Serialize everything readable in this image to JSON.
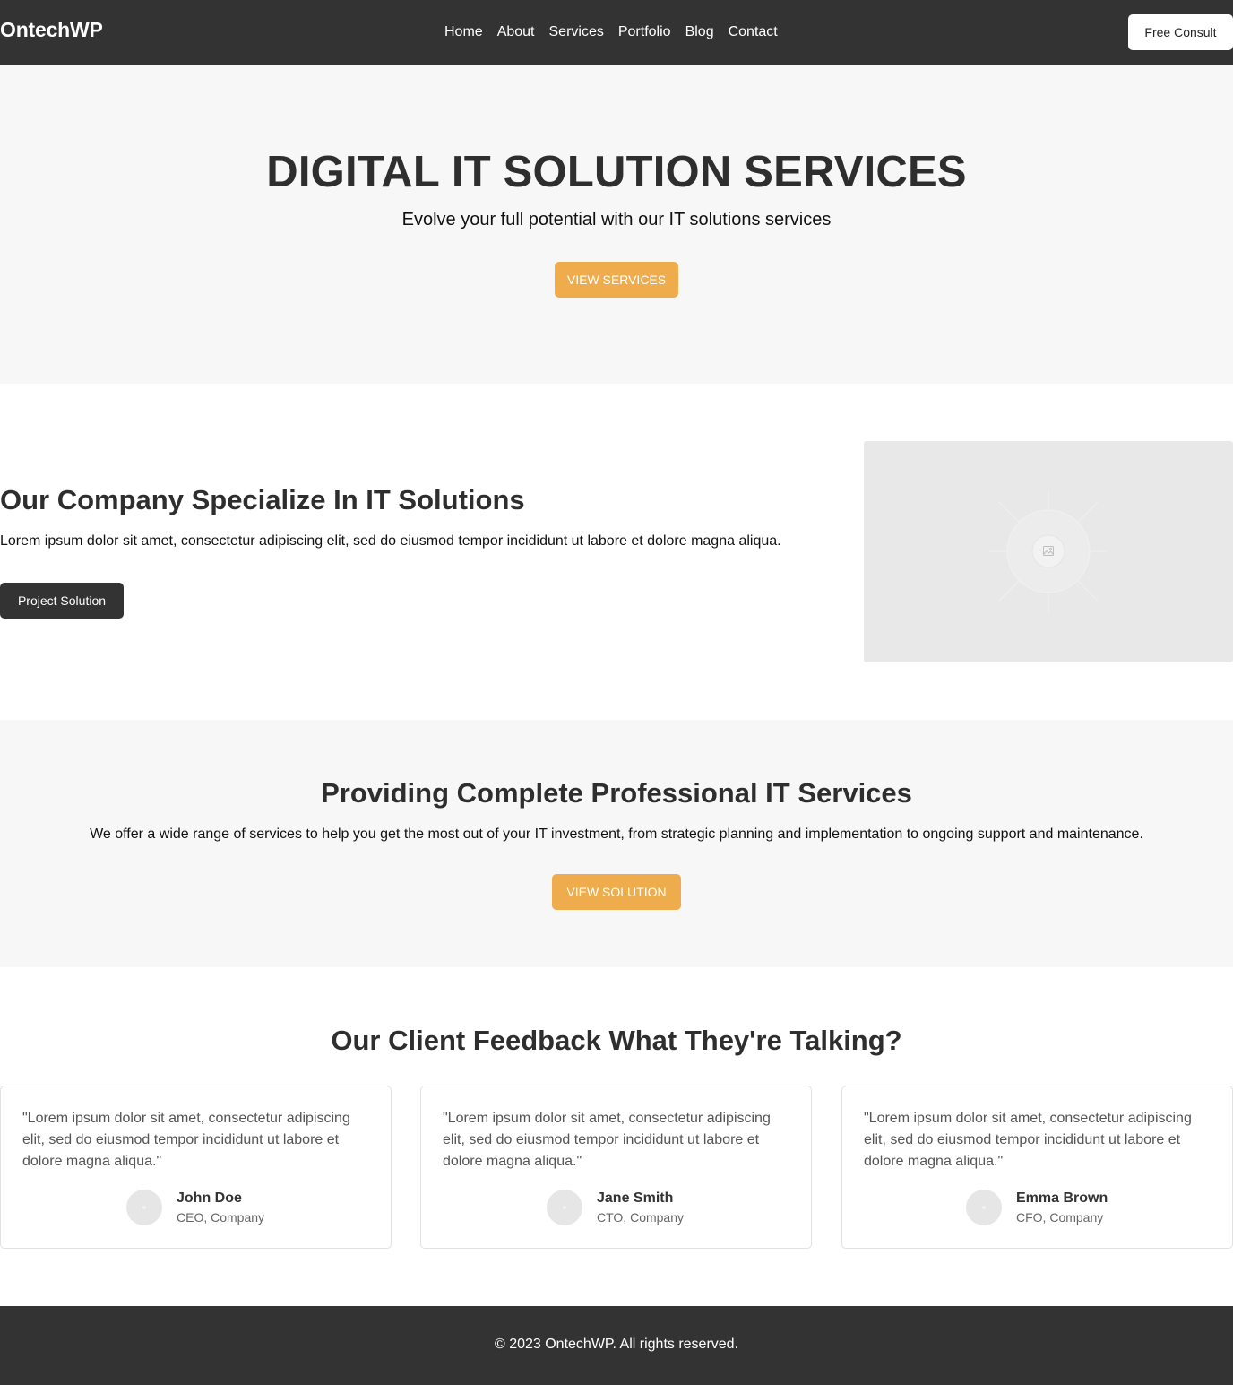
{
  "header": {
    "logo": "OntechWP",
    "nav": [
      "Home",
      "About",
      "Services",
      "Portfolio",
      "Blog",
      "Contact"
    ],
    "consult_label": "Free Consult"
  },
  "hero": {
    "title": "DIGITAL IT SOLUTION SERVICES",
    "subtitle": "Evolve your full potential with our IT solutions services",
    "button_label": "VIEW SERVICES"
  },
  "specialize": {
    "title": "Our Company Specialize In IT Solutions",
    "text": "Lorem ipsum dolor sit amet, consectetur adipiscing elit, sed do eiusmod tempor incididunt ut labore et dolore magna aliqua.",
    "button_label": "Project Solution",
    "image_icon": "image-placeholder-icon"
  },
  "services": {
    "title": "Providing Complete Professional IT Services",
    "text": "We offer a wide range of services to help you get the most out of your IT investment, from strategic planning and implementation to ongoing support and maintenance.",
    "button_label": "VIEW SOLUTION"
  },
  "feedback": {
    "title": "Our Client Feedback What They're Talking?",
    "testimonials": [
      {
        "quote": "\"Lorem ipsum dolor sit amet, consectetur adipiscing elit, sed do eiusmod tempor incididunt ut labore et dolore magna aliqua.\"",
        "name": "John Doe",
        "role": "CEO, Company"
      },
      {
        "quote": "\"Lorem ipsum dolor sit amet, consectetur adipiscing elit, sed do eiusmod tempor incididunt ut labore et dolore magna aliqua.\"",
        "name": "Jane Smith",
        "role": "CTO, Company"
      },
      {
        "quote": "\"Lorem ipsum dolor sit amet, consectetur adipiscing elit, sed do eiusmod tempor incididunt ut labore et dolore magna aliqua.\"",
        "name": "Emma Brown",
        "role": "CFO, Company"
      }
    ]
  },
  "footer": {
    "copyright": "© 2023 OntechWP. All rights reserved."
  },
  "colors": {
    "dark": "#333333",
    "accent": "#eeac4c",
    "light_bg": "#f7f7f7"
  }
}
